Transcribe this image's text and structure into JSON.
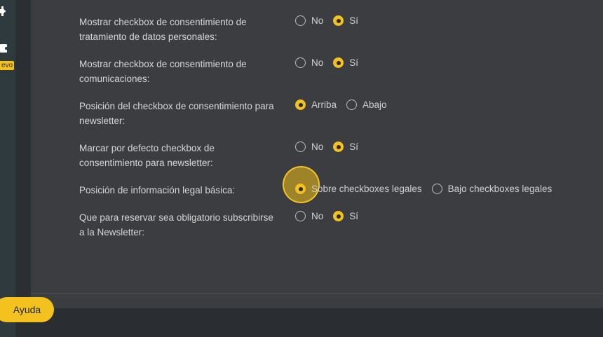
{
  "sidebar": {
    "new_badge": "evo"
  },
  "settings": [
    {
      "label": "Mostrar checkbox de consentimiento de tratamiento de datos personales:",
      "options": [
        {
          "label": "No",
          "selected": false
        },
        {
          "label": "Sí",
          "selected": true
        }
      ]
    },
    {
      "label": "Mostrar checkbox de consentimiento de comunicaciones:",
      "options": [
        {
          "label": "No",
          "selected": false
        },
        {
          "label": "Sí",
          "selected": true
        }
      ]
    },
    {
      "label": "Posición del checkbox de consentimiento para newsletter:",
      "options": [
        {
          "label": "Arriba",
          "selected": true
        },
        {
          "label": "Abajo",
          "selected": false
        }
      ]
    },
    {
      "label": "Marcar por defecto checkbox de consentimiento para newsletter:",
      "options": [
        {
          "label": "No",
          "selected": false
        },
        {
          "label": "Sí",
          "selected": true
        }
      ]
    },
    {
      "label": "Posición de información legal básica:",
      "options": [
        {
          "label": "Sobre checkboxes legales",
          "selected": true
        },
        {
          "label": "Bajo checkboxes legales",
          "selected": false
        }
      ]
    },
    {
      "label": "Que para reservar sea obligatorio subscribirse a la Newsletter:",
      "options": [
        {
          "label": "No",
          "selected": false
        },
        {
          "label": "Sí",
          "selected": true
        }
      ]
    }
  ],
  "help_button": "Ayuda",
  "colors": {
    "accent": "#f4c21e",
    "panel": "#3b3d40",
    "sidebar": "#2f3a3f"
  }
}
